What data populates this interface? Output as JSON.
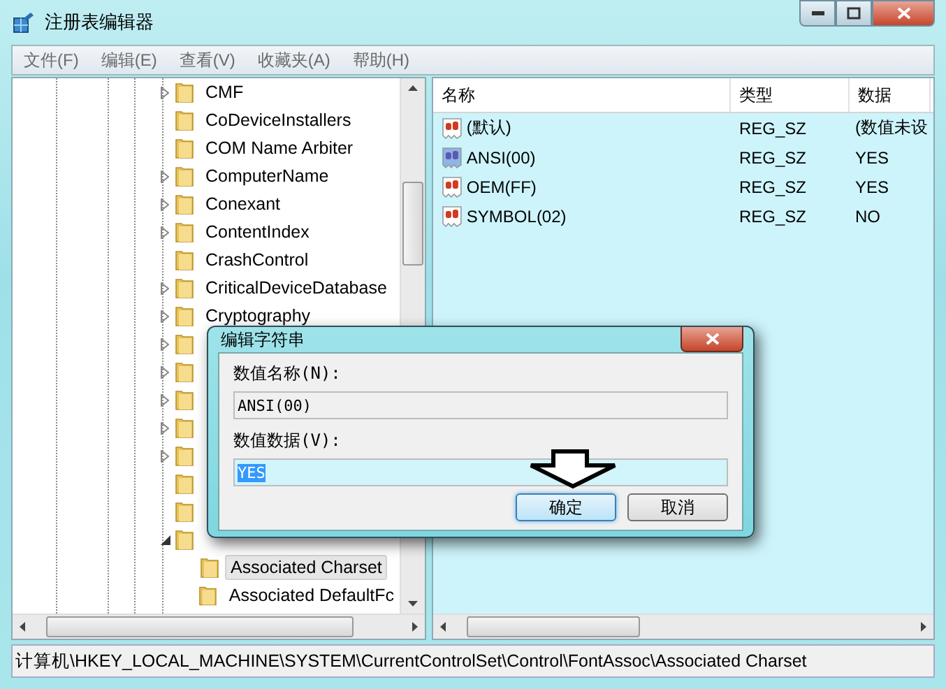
{
  "window": {
    "title": "注册表编辑器"
  },
  "menu": [
    "文件(F)",
    "编辑(E)",
    "查看(V)",
    "收藏夹(A)",
    "帮助(H)"
  ],
  "tree": {
    "items": [
      {
        "name": "CMF",
        "expandable": true,
        "expanded": false,
        "selected": false
      },
      {
        "name": "CoDeviceInstallers",
        "expandable": false,
        "selected": false
      },
      {
        "name": "COM Name Arbiter",
        "expandable": false,
        "selected": false
      },
      {
        "name": "ComputerName",
        "expandable": true,
        "expanded": false,
        "selected": false
      },
      {
        "name": "Conexant",
        "expandable": true,
        "expanded": false,
        "selected": false
      },
      {
        "name": "ContentIndex",
        "expandable": true,
        "expanded": false,
        "selected": false
      },
      {
        "name": "CrashControl",
        "expandable": false,
        "selected": false
      },
      {
        "name": "CriticalDeviceDatabase",
        "expandable": true,
        "expanded": false,
        "selected": false
      },
      {
        "name": "Cryptography",
        "expandable": true,
        "expanded": false,
        "selected": false
      },
      {
        "expandable": true,
        "expanded": false
      },
      {
        "expandable": true,
        "expanded": false
      },
      {
        "expandable": true,
        "expanded": false
      },
      {
        "expandable": true,
        "expanded": false
      },
      {
        "expandable": true,
        "expanded": false
      },
      {
        "expandable": false
      },
      {
        "expandable": false
      },
      {
        "expandable": true,
        "expanded": true,
        "children": [
          {
            "name": "Associated Charset",
            "expandable": false,
            "selected": true
          },
          {
            "name": "Associated DefaultFc",
            "expandable": false,
            "selected": false
          }
        ]
      }
    ]
  },
  "list": {
    "columns": [
      "名称",
      "类型",
      "数据"
    ],
    "rows": [
      {
        "name": "(默认)",
        "type": "REG_SZ",
        "data": "(数值未设",
        "selected": false
      },
      {
        "name": "ANSI(00)",
        "type": "REG_SZ",
        "data": "YES",
        "selected": true
      },
      {
        "name": "OEM(FF)",
        "type": "REG_SZ",
        "data": "YES",
        "selected": false
      },
      {
        "name": "SYMBOL(02)",
        "type": "REG_SZ",
        "data": "NO",
        "selected": false
      }
    ]
  },
  "status_bar": "计算机\\HKEY_LOCAL_MACHINE\\SYSTEM\\CurrentControlSet\\Control\\FontAssoc\\Associated Charset",
  "dialog": {
    "title": "编辑字符串",
    "name_label": "数值名称(N):",
    "name_value": "ANSI(00)",
    "data_label": "数值数据(V):",
    "data_value": "YES",
    "value_selected": true,
    "buttons": [
      {
        "label": "确定",
        "default": true
      },
      {
        "label": "取消",
        "default": false
      }
    ]
  }
}
